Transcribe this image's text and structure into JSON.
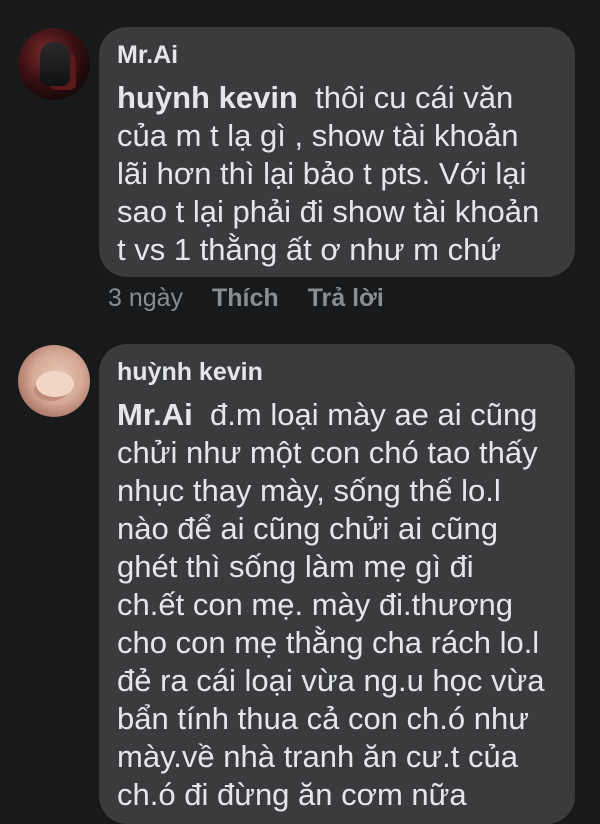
{
  "comments": [
    {
      "author": "Mr.Ai",
      "mention": "huỳnh kevin",
      "lines": [
        "thôi cu cái văn",
        "của m t lạ gì , show tài khoản",
        "lãi hơn thì lại bảo t pts. Với lại",
        "sao t lại phải đi show tài khoản",
        "t vs 1 thằng ất ơ như m chứ"
      ],
      "time": "3 ngày",
      "like_label": "Thích",
      "reply_label": "Trả lời"
    },
    {
      "author": "huỳnh kevin",
      "mention": "Mr.Ai",
      "lines": [
        "đ.m loại mày ae ai cũng",
        "chửi như một con chó tao thấy",
        "nhục thay mày, sống thế lo.l",
        "nào để ai cũng chửi ai cũng",
        "ghét thì sống làm mẹ gì  đi",
        "ch.ết con mẹ. mày đi.thương",
        "cho con mẹ thằng cha rách lo.l",
        "đẻ ra cái loại vừa ng.u học vừa",
        "bẩn tính thua cả con ch.ó như",
        "mày.về nhà tranh ăn cư.t của",
        "ch.ó đi đừng ăn cơm nữa"
      ]
    }
  ],
  "colors": {
    "background": "#18191a",
    "bubble": "#3a3b3c",
    "text": "#e4e6eb",
    "meta": "#8a8d91"
  }
}
